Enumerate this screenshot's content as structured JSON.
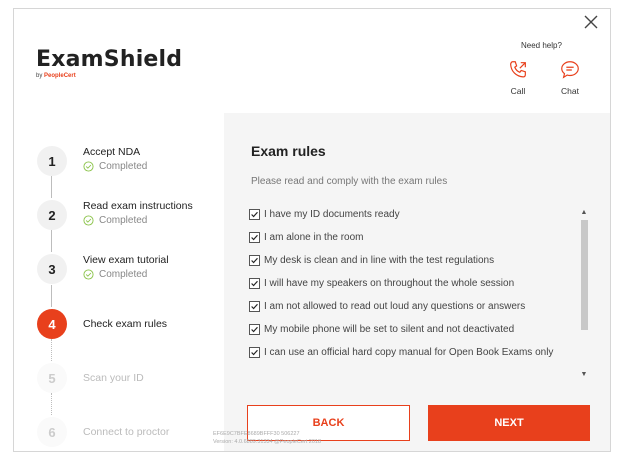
{
  "app": {
    "name": "ExamShield",
    "byline_prefix": "by",
    "byline_brand": "PeopleCert",
    "brand_color": "#e8401c"
  },
  "help": {
    "label": "Need help?",
    "call_label": "Call",
    "chat_label": "Chat"
  },
  "steps": [
    {
      "number": "1",
      "title": "Accept NDA",
      "status": "Completed",
      "state": "completed"
    },
    {
      "number": "2",
      "title": "Read exam instructions",
      "status": "Completed",
      "state": "completed"
    },
    {
      "number": "3",
      "title": "View exam tutorial",
      "status": "Completed",
      "state": "completed"
    },
    {
      "number": "4",
      "title": "Check exam rules",
      "status": "",
      "state": "active"
    },
    {
      "number": "5",
      "title": "Scan your ID",
      "status": "",
      "state": "pending"
    },
    {
      "number": "6",
      "title": "Connect to proctor",
      "status": "",
      "state": "pending"
    }
  ],
  "main": {
    "title": "Exam rules",
    "subtitle": "Please read and comply with the exam rules",
    "rules": [
      "I have my ID documents ready",
      "I am alone in the room",
      "My desk is clean and in line with the test regulations",
      "I will have my speakers on throughout the whole session",
      "I am not allowed to read out loud any questions or answers",
      "My mobile phone will be set to silent and not deactivated",
      "I can use an official hard copy manual for Open Book Exams only"
    ],
    "back_label": "BACK",
    "next_label": "NEXT"
  },
  "footer": {
    "id_line": "EF6E9C7BFE8689BFFF30 506227",
    "version_line": "Version: 4.0.6889.31334 @PeopleCert 2018"
  }
}
